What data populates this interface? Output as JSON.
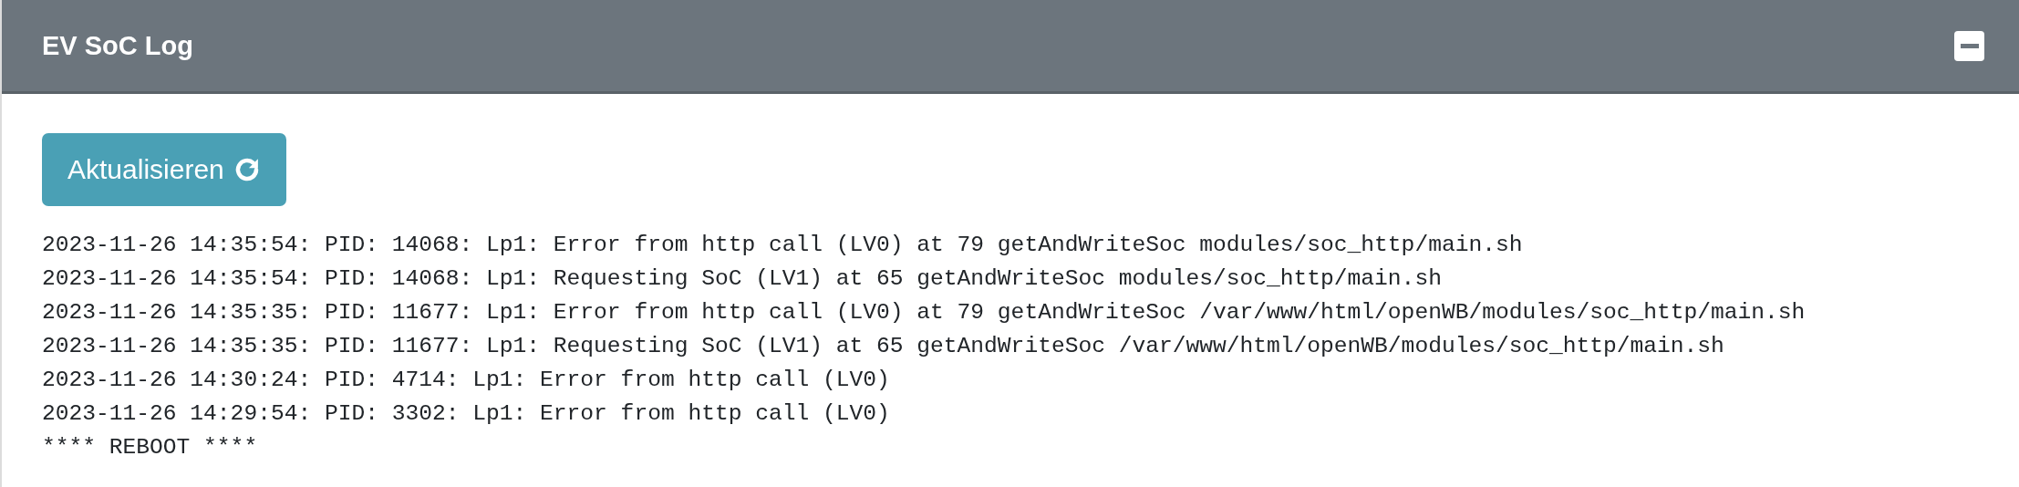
{
  "card": {
    "title": "EV SoC Log"
  },
  "refresh_button": {
    "label": "Aktualisieren"
  },
  "log_lines": [
    "2023-11-26 14:35:54: PID: 14068: Lp1: Error from http call (LV0) at 79 getAndWriteSoc modules/soc_http/main.sh",
    "2023-11-26 14:35:54: PID: 14068: Lp1: Requesting SoC (LV1) at 65 getAndWriteSoc modules/soc_http/main.sh",
    "2023-11-26 14:35:35: PID: 11677: Lp1: Error from http call (LV0) at 79 getAndWriteSoc /var/www/html/openWB/modules/soc_http/main.sh",
    "2023-11-26 14:35:35: PID: 11677: Lp1: Requesting SoC (LV1) at 65 getAndWriteSoc /var/www/html/openWB/modules/soc_http/main.sh",
    "2023-11-26 14:30:24: PID: 4714: Lp1: Error from http call (LV0)",
    "2023-11-26 14:29:54: PID: 3302: Lp1: Error from http call (LV0)",
    "**** REBOOT ****"
  ]
}
